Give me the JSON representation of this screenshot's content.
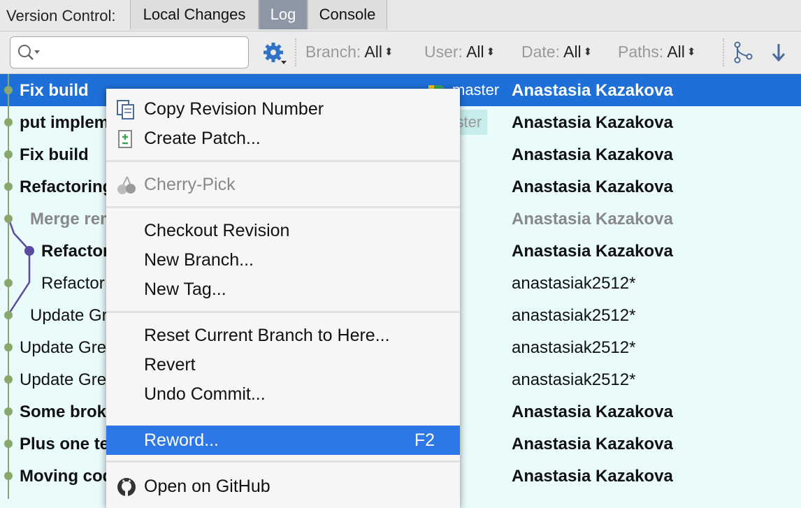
{
  "tabbar": {
    "label": "Version Control:",
    "tabs": [
      {
        "label": "Local Changes",
        "active": false
      },
      {
        "label": "Log",
        "active": true
      },
      {
        "label": "Console",
        "active": false
      }
    ]
  },
  "toolbar": {
    "search_value": "",
    "filters": {
      "branch": {
        "label": "Branch:",
        "value": "All"
      },
      "user": {
        "label": "User:",
        "value": "All"
      },
      "date": {
        "label": "Date:",
        "value": "All"
      },
      "paths": {
        "label": "Paths:",
        "value": "All"
      }
    }
  },
  "commits": [
    {
      "message": "Fix build",
      "author": "Anastasia Kazakova",
      "bold": true,
      "selected": true
    },
    {
      "message": "put implementation to header",
      "author": "Anastasia Kazakova",
      "bold": true
    },
    {
      "message": "Fix build",
      "author": "Anastasia Kazakova",
      "bold": true
    },
    {
      "message": "Refactoring",
      "author": "Anastasia Kazakova",
      "bold": true
    },
    {
      "message": "Merge remote-tracking branch 'origin/master'",
      "author": "Anastasia Kazakova",
      "bold": true,
      "dim": true
    },
    {
      "message": "Refactoring",
      "author": "Anastasia Kazakova",
      "bold": true
    },
    {
      "message": "Refactor LastMonthDay calculation function",
      "author": "anastasiak2512*",
      "bold": false
    },
    {
      "message": "Update GregorianCalendar.cpp",
      "author": "anastasiak2512*",
      "bold": false
    },
    {
      "message": "Update GregorianCalendar.cpp",
      "author": "anastasiak2512*",
      "bold": false
    },
    {
      "message": "Update GregorianCalendar.cpp",
      "author": "anastasiak2512*",
      "bold": false
    },
    {
      "message": "Some broken builds, etc. fixes",
      "author": "Anastasia Kazakova",
      "bold": true
    },
    {
      "message": "Plus one test",
      "author": "Anastasia Kazakova",
      "bold": true
    },
    {
      "message": "Moving code around for tips",
      "author": "Anastasia Kazakova",
      "bold": true
    }
  ],
  "refs": {
    "master": "master",
    "origin_master": "origin/master"
  },
  "context_menu": {
    "items": {
      "copy_revision": "Copy Revision Number",
      "create_patch": "Create Patch...",
      "cherry_pick": "Cherry-Pick",
      "checkout_revision": "Checkout Revision",
      "new_branch": "New Branch...",
      "new_tag": "New Tag...",
      "reset_branch": "Reset Current Branch to Here...",
      "revert": "Revert",
      "undo_commit": "Undo Commit...",
      "reword": "Reword...",
      "reword_shortcut": "F2",
      "open_github": "Open on GitHub"
    }
  },
  "colors": {
    "selection": "#1f6fd8",
    "menu_highlight": "#2d78e6",
    "graph_green": "#8aa86e",
    "graph_purple": "#5b4aa0",
    "log_background": "#e9fbfb"
  }
}
